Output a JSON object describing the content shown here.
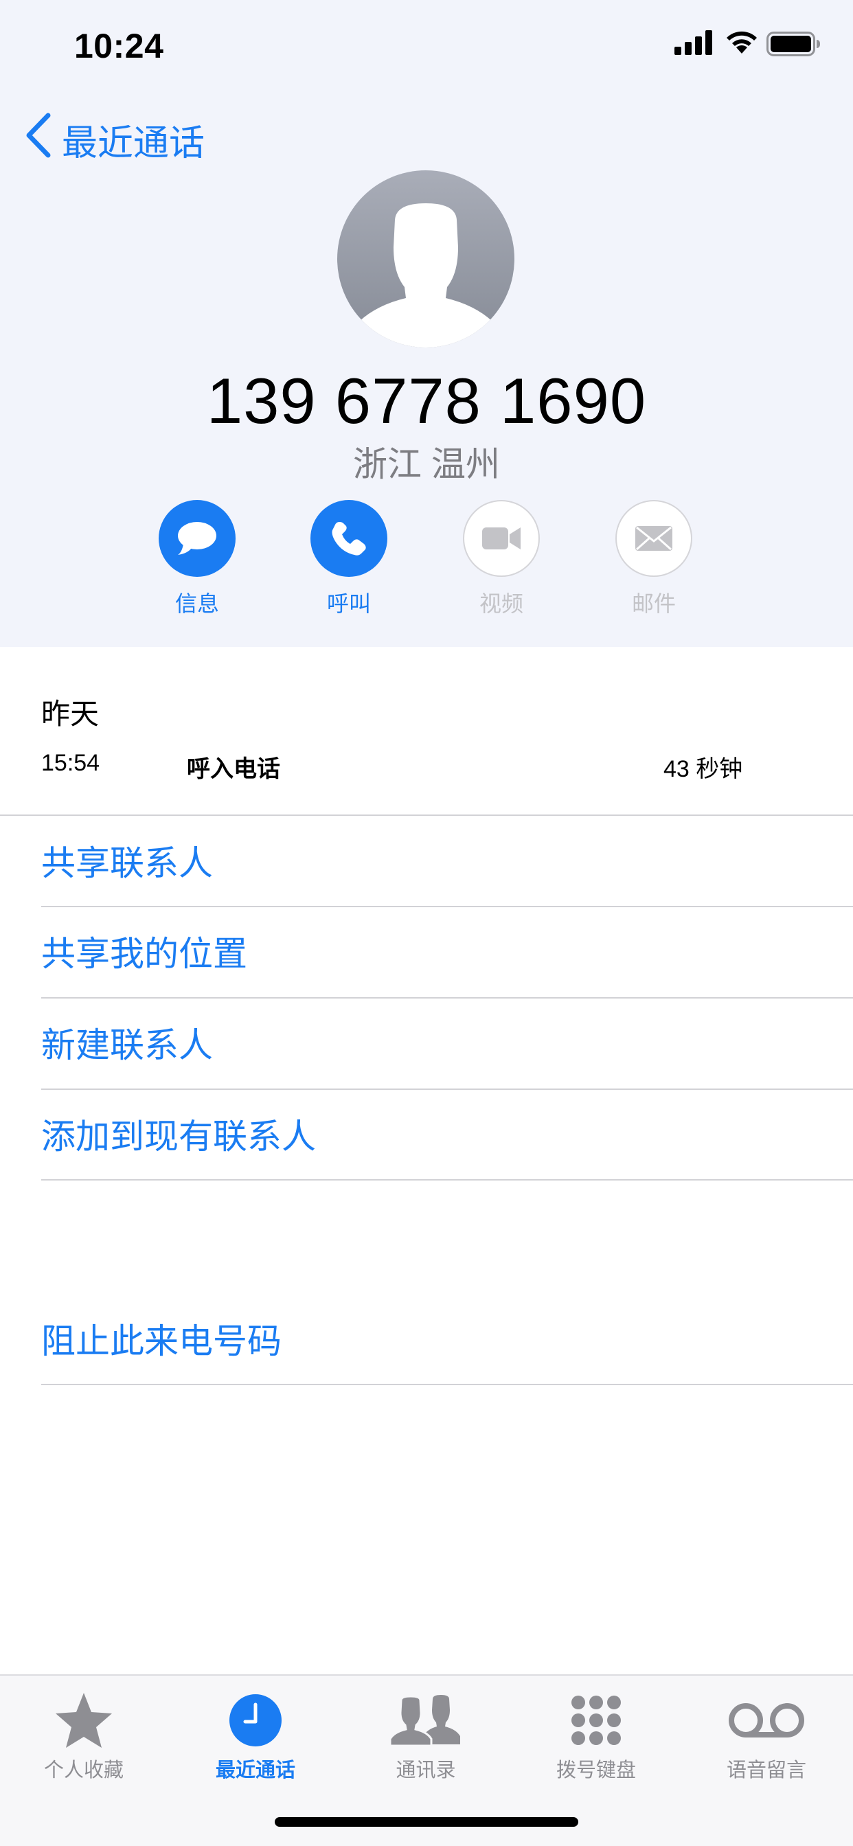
{
  "status_bar": {
    "time": "10:24",
    "icons": [
      "cellular-signal-icon",
      "wifi-icon",
      "battery-icon"
    ]
  },
  "nav": {
    "back_label": "最近通话"
  },
  "contact": {
    "phone_number": "139 6778 1690",
    "location": "浙江 温州"
  },
  "actions": [
    {
      "label": "信息",
      "icon": "message-bubble-icon",
      "enabled": true
    },
    {
      "label": "呼叫",
      "icon": "phone-icon",
      "enabled": true
    },
    {
      "label": "视频",
      "icon": "video-camera-icon",
      "enabled": false
    },
    {
      "label": "邮件",
      "icon": "envelope-icon",
      "enabled": false
    }
  ],
  "call_log": {
    "date": "昨天",
    "time": "15:54",
    "type": "呼入电话",
    "duration": "43 秒钟"
  },
  "options": [
    {
      "label": "共享联系人"
    },
    {
      "label": "共享我的位置"
    },
    {
      "label": "新建联系人"
    },
    {
      "label": "添加到现有联系人"
    }
  ],
  "block_option": {
    "label": "阻止此来电号码"
  },
  "tab_bar": [
    {
      "label": "个人收藏",
      "icon": "star-icon",
      "active": false
    },
    {
      "label": "最近通话",
      "icon": "clock-icon",
      "active": true
    },
    {
      "label": "通讯录",
      "icon": "contacts-icon",
      "active": false
    },
    {
      "label": "拨号键盘",
      "icon": "keypad-icon",
      "active": false
    },
    {
      "label": "语音留言",
      "icon": "voicemail-icon",
      "active": false
    }
  ],
  "colors": {
    "accent": "#1a7cf2",
    "header_bg": "#f2f4fb",
    "inactive_gray": "#8e8e93",
    "separator": "#d2d2d6"
  }
}
